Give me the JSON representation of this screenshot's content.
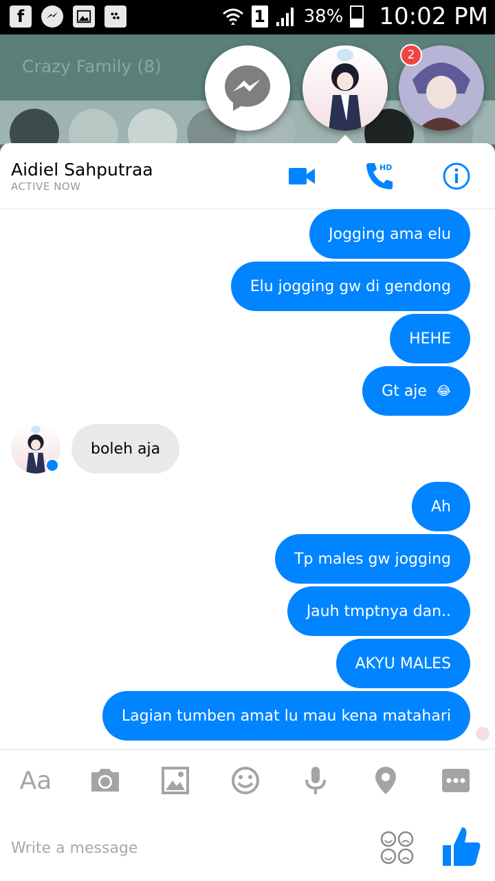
{
  "status_bar": {
    "battery": "38%",
    "time": "10:02 PM",
    "sim": "1"
  },
  "background_app": {
    "title": "Crazy Family (8)"
  },
  "chat_heads": {
    "badge_count": "2"
  },
  "chat": {
    "contact_name": "Aidiel Sahputraa",
    "contact_status": "ACTIVE NOW",
    "messages": [
      {
        "dir": "out",
        "text": "Jogging ama elu"
      },
      {
        "dir": "out",
        "text": "Elu jogging gw di gendong"
      },
      {
        "dir": "out",
        "text": "HEHE"
      },
      {
        "dir": "out",
        "text": "Gt aje",
        "emoji": "😂"
      },
      {
        "dir": "in",
        "text": "boleh aja"
      },
      {
        "dir": "out",
        "text": "Ah"
      },
      {
        "dir": "out",
        "text": "Tp males gw jogging"
      },
      {
        "dir": "out",
        "text": "Jauh tmptnya dan.."
      },
      {
        "dir": "out",
        "text": "AKYU MALES"
      },
      {
        "dir": "out",
        "text": "Lagian tumben amat lu mau kena matahari"
      }
    ]
  },
  "toolbar": {
    "text_label": "Aa"
  },
  "composer": {
    "placeholder": "Write a message"
  },
  "colors": {
    "accent": "#0084ff",
    "incoming_bubble": "#e9e9e9"
  }
}
